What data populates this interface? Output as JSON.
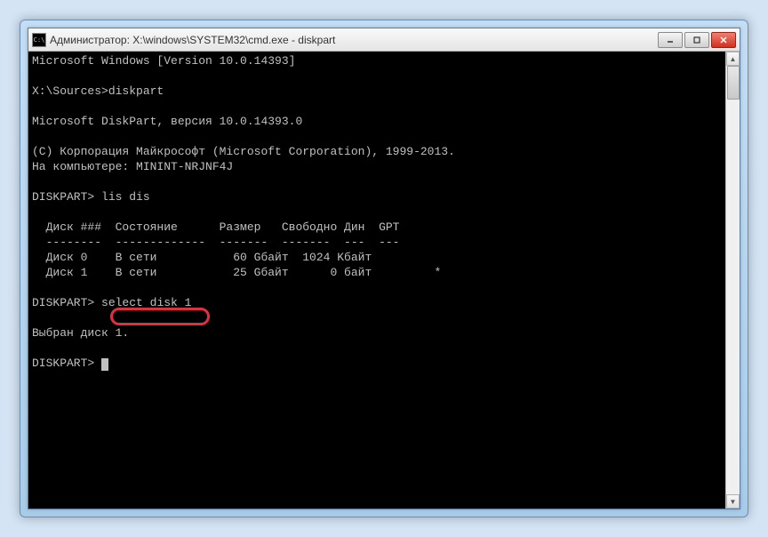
{
  "window": {
    "title": "Администратор: X:\\windows\\SYSTEM32\\cmd.exe - diskpart",
    "icon_label": "C:\\"
  },
  "terminal": {
    "header": "Microsoft Windows [Version 10.0.14393]",
    "prompt_path": "X:\\Sources>",
    "cmd1": "diskpart",
    "diskpart_header": "Microsoft DiskPart, версия 10.0.14393.0",
    "copyright": "(C) Корпорация Майкрософт (Microsoft Corporation), 1999-2013.",
    "computer_line": "На компьютере: MININT-NRJNF4J",
    "diskpart_prompt": "DISKPART>",
    "cmd2": "lis dis",
    "table": {
      "headers": "  Диск ###  Состояние      Размер   Свободно Дин  GPT",
      "divider": "  --------  -------------  -------  -------  ---  ---",
      "row0": "  Диск 0    В сети           60 Gбайт  1024 Kбайт",
      "row1": "  Диск 1    В сети           25 Gбайт      0 байт         *"
    },
    "cmd3": "select disk 1",
    "result": "Выбран диск 1."
  }
}
